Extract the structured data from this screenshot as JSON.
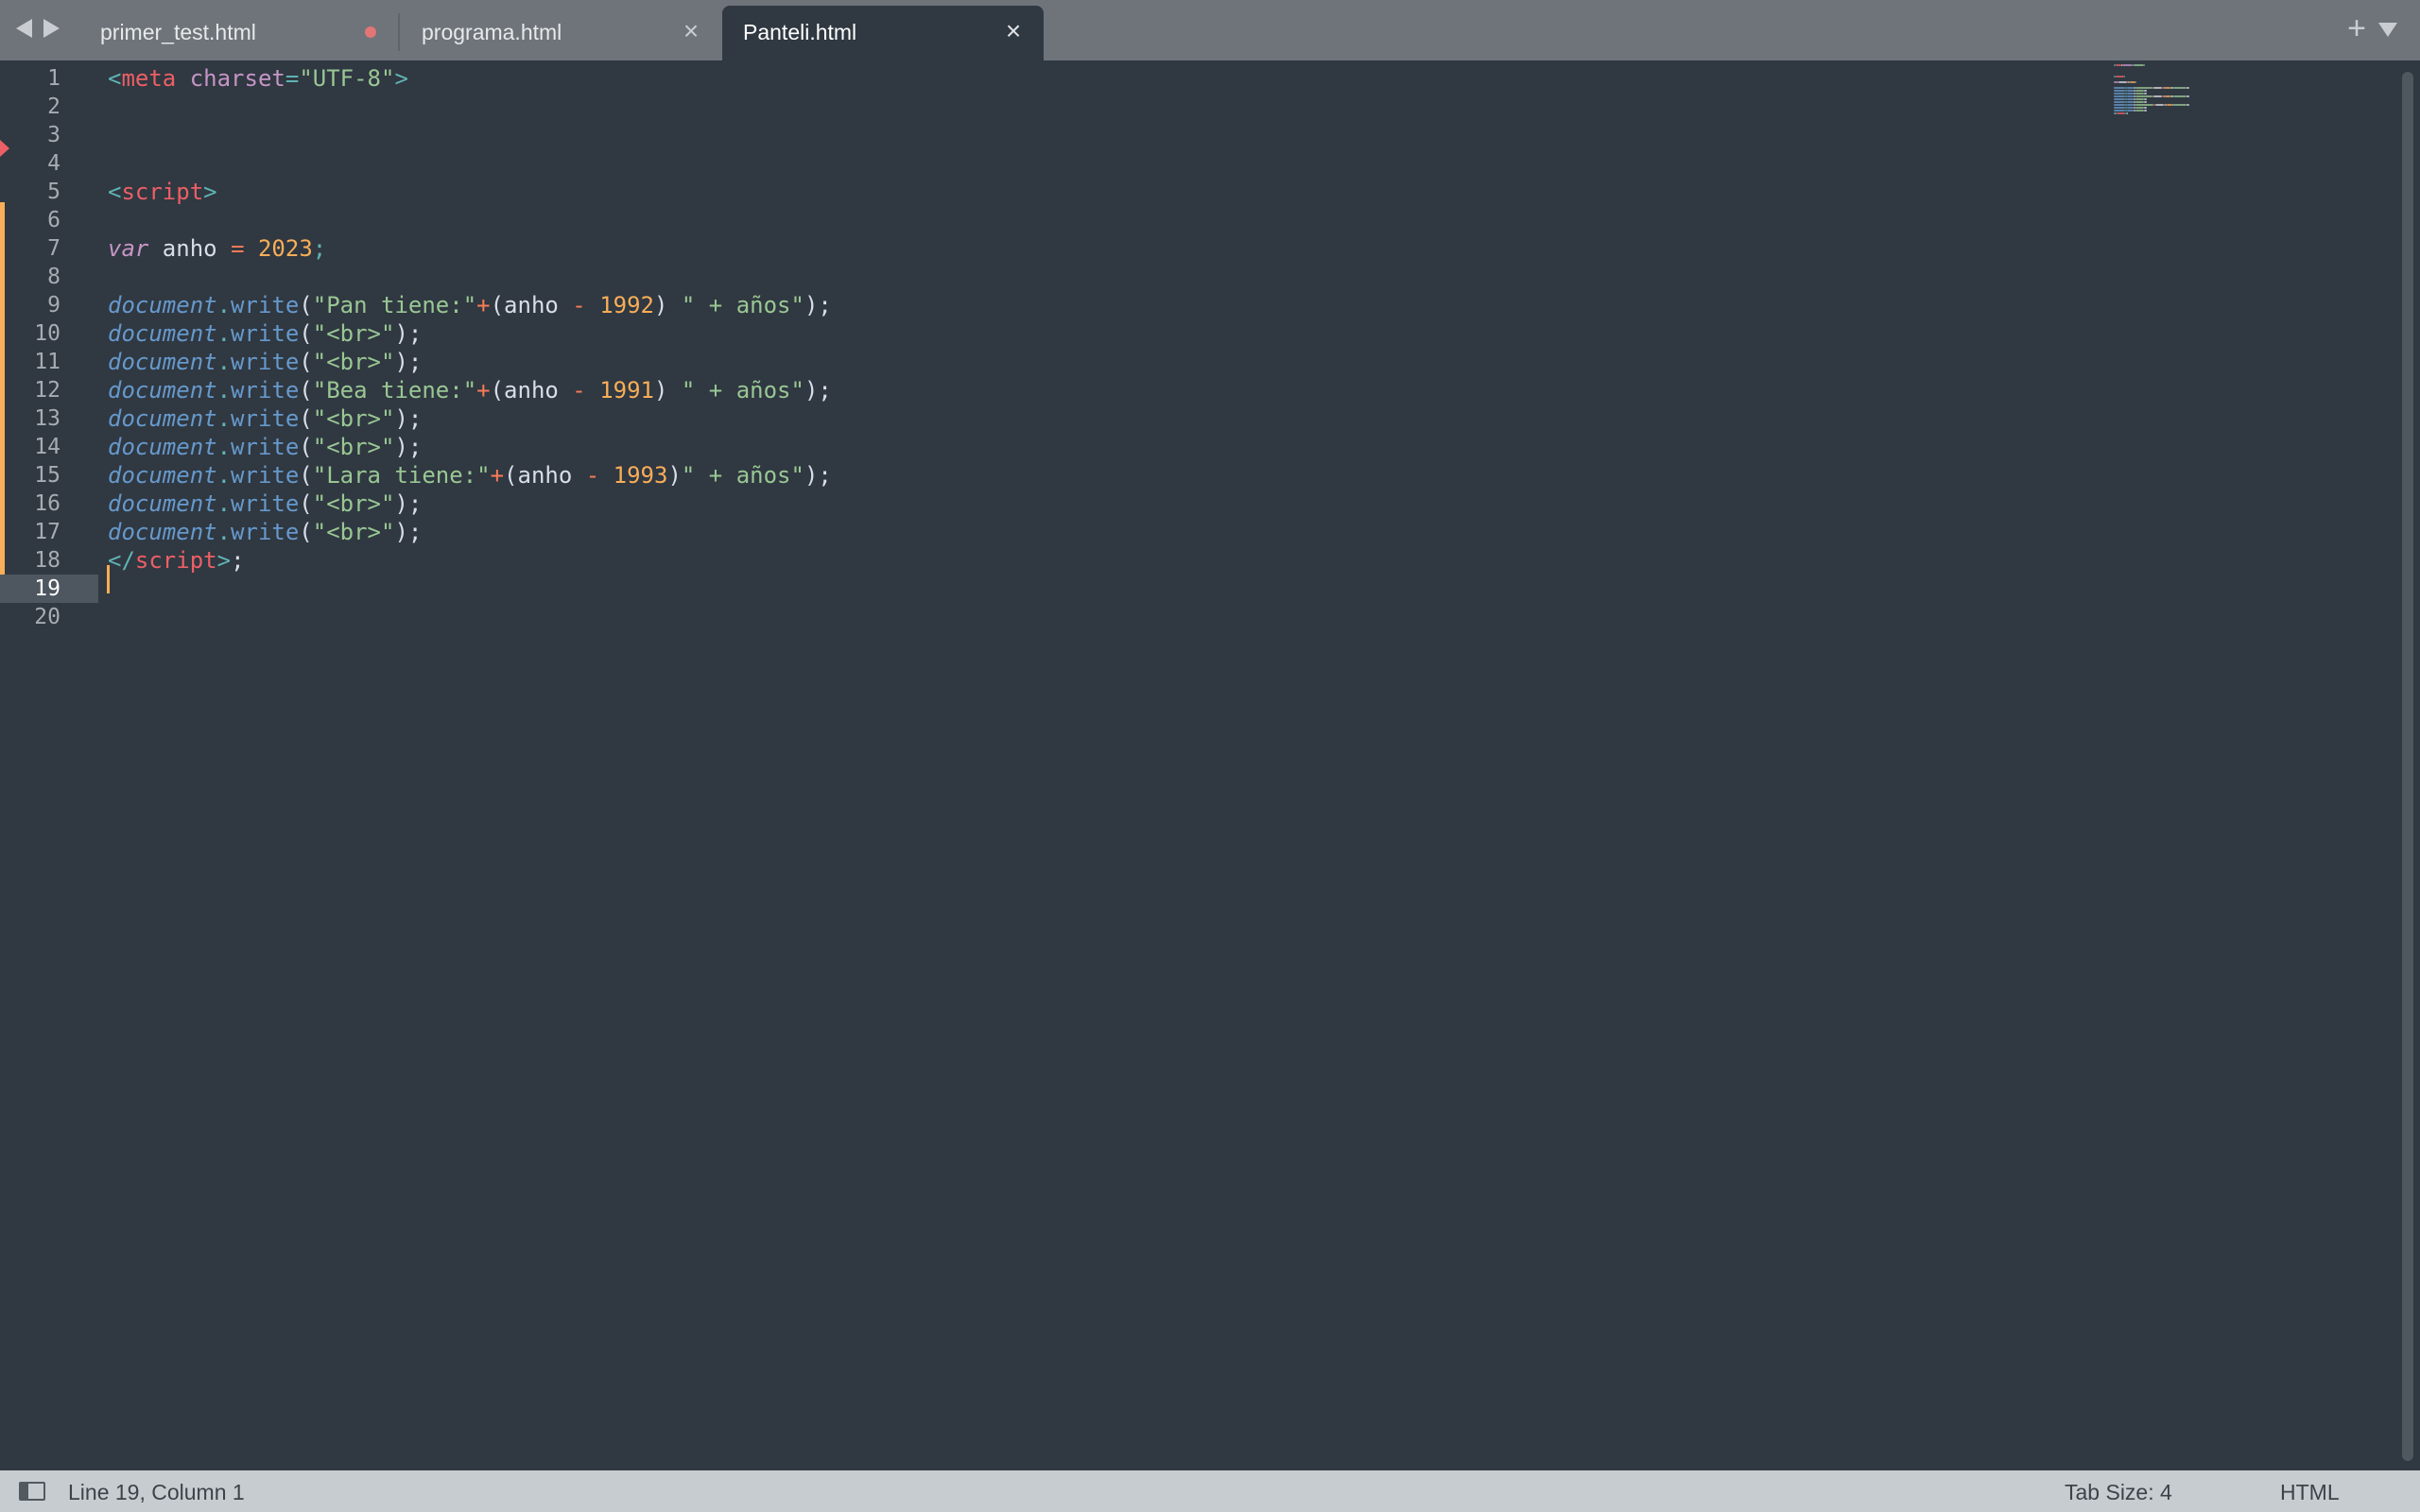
{
  "tabs": [
    {
      "label": "primer_test.html",
      "active": false,
      "dirty": true
    },
    {
      "label": "programa.html",
      "active": false,
      "dirty": false
    },
    {
      "label": "Panteli.html",
      "active": true,
      "dirty": false
    }
  ],
  "tab_bar": {
    "new_tab_glyph": "+",
    "close_glyph": "×"
  },
  "editor": {
    "current_line": 19,
    "line_numbers": [
      "1",
      "2",
      "3",
      "4",
      "5",
      "6",
      "7",
      "8",
      "9",
      "10",
      "11",
      "12",
      "13",
      "14",
      "15",
      "16",
      "17",
      "18",
      "19",
      "20"
    ],
    "lines": [
      [
        {
          "t": "<",
          "c": "punct"
        },
        {
          "t": "meta",
          "c": "tag"
        },
        {
          "t": " ",
          "c": "plain"
        },
        {
          "t": "charset",
          "c": "attr"
        },
        {
          "t": "=",
          "c": "punct"
        },
        {
          "t": "\"UTF-8\"",
          "c": "str"
        },
        {
          "t": ">",
          "c": "punct"
        }
      ],
      [],
      [],
      [],
      [
        {
          "t": "<",
          "c": "punct"
        },
        {
          "t": "script",
          "c": "tag"
        },
        {
          "t": ">",
          "c": "punct"
        }
      ],
      [],
      [
        {
          "t": "var",
          "c": "kw"
        },
        {
          "t": " anho ",
          "c": "ident"
        },
        {
          "t": "=",
          "c": "op"
        },
        {
          "t": " ",
          "c": "plain"
        },
        {
          "t": "2023",
          "c": "num"
        },
        {
          "t": ";",
          "c": "punct"
        }
      ],
      [],
      [
        {
          "t": "document",
          "c": "obj"
        },
        {
          "t": ".",
          "c": "punct"
        },
        {
          "t": "write",
          "c": "method"
        },
        {
          "t": "(",
          "c": "plain"
        },
        {
          "t": "\"Pan tiene:\"",
          "c": "str"
        },
        {
          "t": "+",
          "c": "op"
        },
        {
          "t": "(anho ",
          "c": "plain"
        },
        {
          "t": "-",
          "c": "op"
        },
        {
          "t": " ",
          "c": "plain"
        },
        {
          "t": "1992",
          "c": "num"
        },
        {
          "t": ") ",
          "c": "plain"
        },
        {
          "t": "\" + años\"",
          "c": "str"
        },
        {
          "t": ");",
          "c": "plain"
        }
      ],
      [
        {
          "t": "document",
          "c": "obj"
        },
        {
          "t": ".",
          "c": "punct"
        },
        {
          "t": "write",
          "c": "method"
        },
        {
          "t": "(",
          "c": "plain"
        },
        {
          "t": "\"<br>\"",
          "c": "str"
        },
        {
          "t": ");",
          "c": "plain"
        }
      ],
      [
        {
          "t": "document",
          "c": "obj"
        },
        {
          "t": ".",
          "c": "punct"
        },
        {
          "t": "write",
          "c": "method"
        },
        {
          "t": "(",
          "c": "plain"
        },
        {
          "t": "\"<br>\"",
          "c": "str"
        },
        {
          "t": ");",
          "c": "plain"
        }
      ],
      [
        {
          "t": "document",
          "c": "obj"
        },
        {
          "t": ".",
          "c": "punct"
        },
        {
          "t": "write",
          "c": "method"
        },
        {
          "t": "(",
          "c": "plain"
        },
        {
          "t": "\"Bea tiene:\"",
          "c": "str"
        },
        {
          "t": "+",
          "c": "op"
        },
        {
          "t": "(anho ",
          "c": "plain"
        },
        {
          "t": "-",
          "c": "op"
        },
        {
          "t": " ",
          "c": "plain"
        },
        {
          "t": "1991",
          "c": "num"
        },
        {
          "t": ") ",
          "c": "plain"
        },
        {
          "t": "\" + años\"",
          "c": "str"
        },
        {
          "t": ");",
          "c": "plain"
        }
      ],
      [
        {
          "t": "document",
          "c": "obj"
        },
        {
          "t": ".",
          "c": "punct"
        },
        {
          "t": "write",
          "c": "method"
        },
        {
          "t": "(",
          "c": "plain"
        },
        {
          "t": "\"<br>\"",
          "c": "str"
        },
        {
          "t": ");",
          "c": "plain"
        }
      ],
      [
        {
          "t": "document",
          "c": "obj"
        },
        {
          "t": ".",
          "c": "punct"
        },
        {
          "t": "write",
          "c": "method"
        },
        {
          "t": "(",
          "c": "plain"
        },
        {
          "t": "\"<br>\"",
          "c": "str"
        },
        {
          "t": ");",
          "c": "plain"
        }
      ],
      [
        {
          "t": "document",
          "c": "obj"
        },
        {
          "t": ".",
          "c": "punct"
        },
        {
          "t": "write",
          "c": "method"
        },
        {
          "t": "(",
          "c": "plain"
        },
        {
          "t": "\"Lara tiene:\"",
          "c": "str"
        },
        {
          "t": "+",
          "c": "op"
        },
        {
          "t": "(anho ",
          "c": "plain"
        },
        {
          "t": "-",
          "c": "op"
        },
        {
          "t": " ",
          "c": "plain"
        },
        {
          "t": "1993",
          "c": "num"
        },
        {
          "t": ")",
          "c": "plain"
        },
        {
          "t": "\" + años\"",
          "c": "str"
        },
        {
          "t": ");",
          "c": "plain"
        }
      ],
      [
        {
          "t": "document",
          "c": "obj"
        },
        {
          "t": ".",
          "c": "punct"
        },
        {
          "t": "write",
          "c": "method"
        },
        {
          "t": "(",
          "c": "plain"
        },
        {
          "t": "\"<br>\"",
          "c": "str"
        },
        {
          "t": ");",
          "c": "plain"
        }
      ],
      [
        {
          "t": "document",
          "c": "obj"
        },
        {
          "t": ".",
          "c": "punct"
        },
        {
          "t": "write",
          "c": "method"
        },
        {
          "t": "(",
          "c": "plain"
        },
        {
          "t": "\"<br>\"",
          "c": "str"
        },
        {
          "t": ");",
          "c": "plain"
        }
      ],
      [
        {
          "t": "</",
          "c": "punct"
        },
        {
          "t": "script",
          "c": "tag"
        },
        {
          "t": ">",
          "c": "punct"
        },
        {
          "t": ";",
          "c": "plain"
        }
      ],
      [],
      []
    ]
  },
  "status_bar": {
    "position": "Line 19, Column 1",
    "tab_size": "Tab Size: 4",
    "syntax": "HTML"
  },
  "colors": {
    "editor_bg": "#303841",
    "tab_bar_bg": "#6e7479",
    "status_bar_bg": "#c7ccd1",
    "accent_orange": "#f9ae58",
    "tag_red": "#ec5f66",
    "string_green": "#99c794",
    "keyword_purple": "#c695c6",
    "object_blue": "#6699cc",
    "punct_teal": "#5fb4b4",
    "operator_orange": "#f97b58"
  }
}
